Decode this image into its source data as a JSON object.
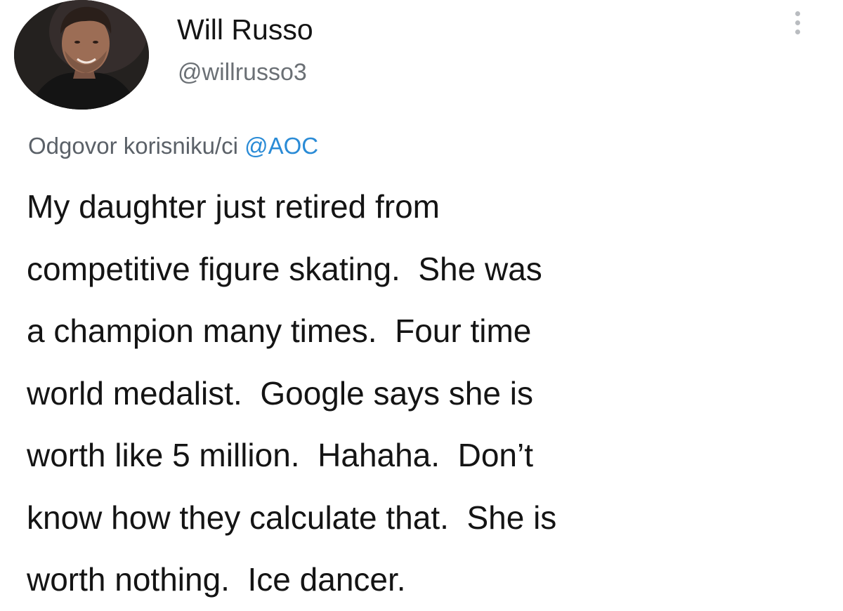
{
  "author": {
    "display_name": "Will Russo",
    "handle": "@willrusso3"
  },
  "reply": {
    "prefix": "Odgovor korisniku/ci ",
    "mention": "@AOC"
  },
  "tweet": {
    "lines": [
      "My daughter just retired from",
      "competitive figure skating.  She was",
      "a champion many times.  Four time",
      "world medalist.  Google says she is",
      "worth like 5 million.  Hahaha.  Don’t",
      "know how they calculate that.  She is",
      "worth nothing.  Ice dancer."
    ]
  },
  "icons": {
    "more": "more-vertical-icon",
    "avatar": "profile-photo"
  },
  "colors": {
    "text": "#141414",
    "secondary": "#6b7075",
    "mention": "#2a8bd6",
    "more_dots": "#b9bcc0"
  }
}
